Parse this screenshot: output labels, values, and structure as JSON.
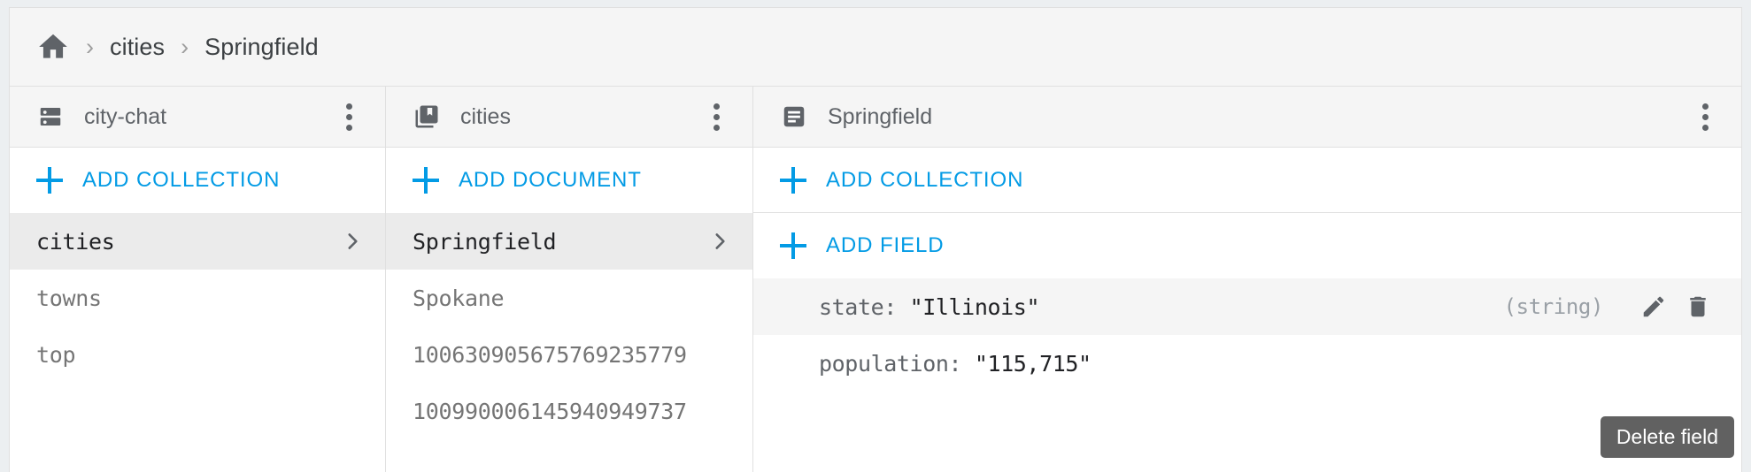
{
  "breadcrumb": {
    "home_icon": "home-icon",
    "separator": "›",
    "items": [
      {
        "label": "cities"
      },
      {
        "label": "Springfield"
      }
    ]
  },
  "panels": {
    "database": {
      "icon": "database-icon",
      "title": "city-chat",
      "menu_icon": "more-vert-icon",
      "add_label": "ADD COLLECTION",
      "items": [
        {
          "label": "cities",
          "selected": true
        },
        {
          "label": "towns",
          "selected": false
        },
        {
          "label": "top",
          "selected": false
        }
      ]
    },
    "collection": {
      "icon": "collection-icon",
      "title": "cities",
      "menu_icon": "more-vert-icon",
      "add_label": "ADD DOCUMENT",
      "items": [
        {
          "label": "Springfield",
          "selected": true
        },
        {
          "label": "Spokane",
          "selected": false
        },
        {
          "label": "100630905675769235779",
          "selected": false
        },
        {
          "label": "100990006145940949737",
          "selected": false
        }
      ]
    },
    "document": {
      "icon": "document-icon",
      "title": "Springfield",
      "menu_icon": "more-vert-icon",
      "add_collection_label": "ADD COLLECTION",
      "add_field_label": "ADD FIELD",
      "fields": [
        {
          "key": "state:",
          "value": "\"Illinois\"",
          "type": "(string)",
          "highlight": true,
          "edit_icon": "pencil-icon",
          "delete_icon": "trash-icon"
        },
        {
          "key": "population:",
          "value": "\"115,715\"",
          "type": "",
          "highlight": false,
          "edit_icon": "pencil-icon",
          "delete_icon": "trash-icon"
        }
      ]
    }
  },
  "tooltip": {
    "text": "Delete field"
  },
  "colors": {
    "accent": "#039be5",
    "page_bg": "#eceff1",
    "panel_bg": "#ffffff",
    "header_bg": "#f5f5f5",
    "selected_row": "#ebebeb",
    "icon_grey": "#5f6368",
    "tooltip_bg": "#616161"
  }
}
